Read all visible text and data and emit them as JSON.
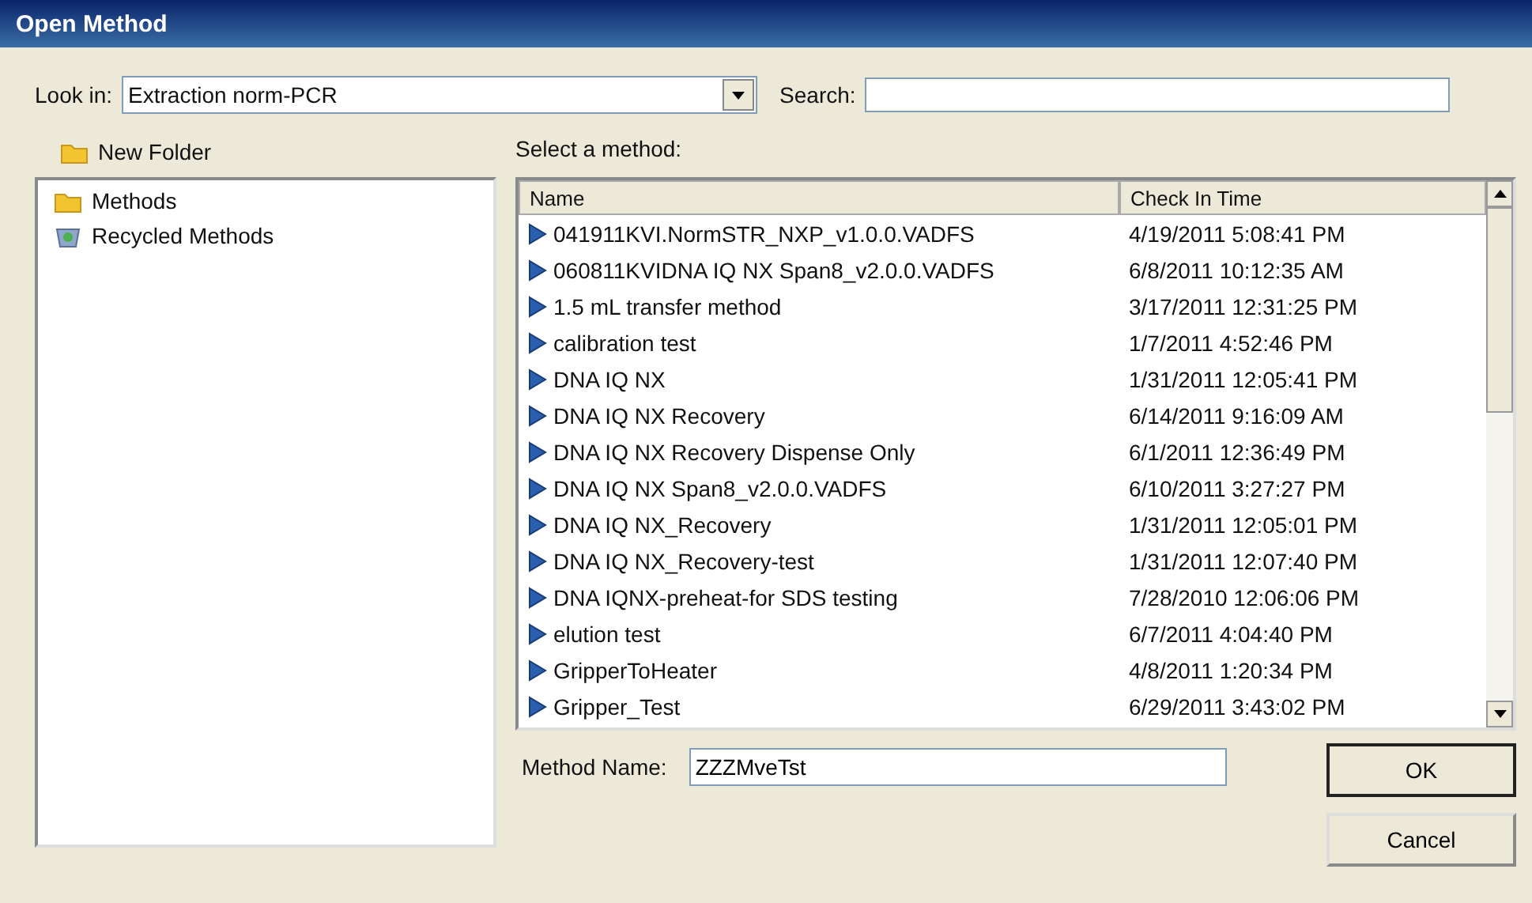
{
  "window": {
    "title": "Open Method"
  },
  "look_in": {
    "label": "Look in:",
    "value": "Extraction norm-PCR"
  },
  "search": {
    "label": "Search:"
  },
  "new_folder": "New Folder",
  "folders": [
    {
      "name": "Methods",
      "kind": "folder"
    },
    {
      "name": "Recycled Methods",
      "kind": "recycle"
    }
  ],
  "list_label": "Select a method:",
  "table": {
    "columns": [
      "Name",
      "Check In Time"
    ],
    "rows": [
      {
        "name": "041911KVI.NormSTR_NXP_v1.0.0.VADFS",
        "time": "4/19/2011 5:08:41 PM"
      },
      {
        "name": "060811KVIDNA IQ NX Span8_v2.0.0.VADFS",
        "time": "6/8/2011 10:12:35 AM"
      },
      {
        "name": "1.5 mL transfer method",
        "time": "3/17/2011 12:31:25 PM"
      },
      {
        "name": "calibration test",
        "time": "1/7/2011 4:52:46 PM"
      },
      {
        "name": "DNA IQ NX",
        "time": "1/31/2011 12:05:41 PM"
      },
      {
        "name": "DNA IQ NX Recovery",
        "time": "6/14/2011 9:16:09 AM"
      },
      {
        "name": "DNA IQ NX Recovery Dispense Only",
        "time": "6/1/2011 12:36:49 PM"
      },
      {
        "name": "DNA IQ NX Span8_v2.0.0.VADFS",
        "time": "6/10/2011 3:27:27 PM"
      },
      {
        "name": "DNA IQ NX_Recovery",
        "time": "1/31/2011 12:05:01 PM"
      },
      {
        "name": "DNA IQ NX_Recovery-test",
        "time": "1/31/2011 12:07:40 PM"
      },
      {
        "name": "DNA IQNX-preheat-for SDS testing",
        "time": "7/28/2010 12:06:06 PM"
      },
      {
        "name": "elution test",
        "time": "6/7/2011 4:04:40 PM"
      },
      {
        "name": "GripperToHeater",
        "time": "4/8/2011 1:20:34 PM"
      },
      {
        "name": "Gripper_Test",
        "time": "6/29/2011 3:43:02 PM"
      }
    ]
  },
  "method_name": {
    "label": "Method Name:",
    "value": "ZZZMveTst"
  },
  "buttons": [
    "OK",
    "Cancel"
  ]
}
